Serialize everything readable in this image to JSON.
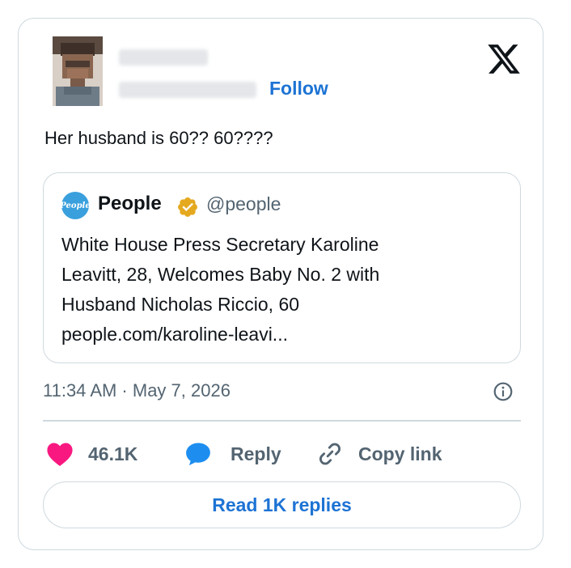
{
  "author": {
    "follow_label": "Follow"
  },
  "tweet": {
    "text": "Her husband is 60?? 60????",
    "timestamp": "11:34 AM · May 7, 2026"
  },
  "quoted": {
    "avatar_text": "People",
    "name": "People",
    "handle": "@people",
    "lines": [
      "White House Press Secretary Karoline",
      "Leavitt, 28, Welcomes Baby No. 2 with",
      "Husband Nicholas Riccio, 60",
      "people.com/karoline-leavi..."
    ]
  },
  "actions": {
    "like_count": "46.1K",
    "reply_label": "Reply",
    "copy_label": "Copy link"
  },
  "read_replies_label": "Read 1K replies",
  "icons": [
    "x-logo-icon",
    "verified-badge-icon",
    "info-icon",
    "heart-icon",
    "reply-bubble-icon",
    "link-icon"
  ],
  "colors": {
    "accent": "#1d73d4",
    "like": "#f91880",
    "badge": "#e5a91f"
  }
}
